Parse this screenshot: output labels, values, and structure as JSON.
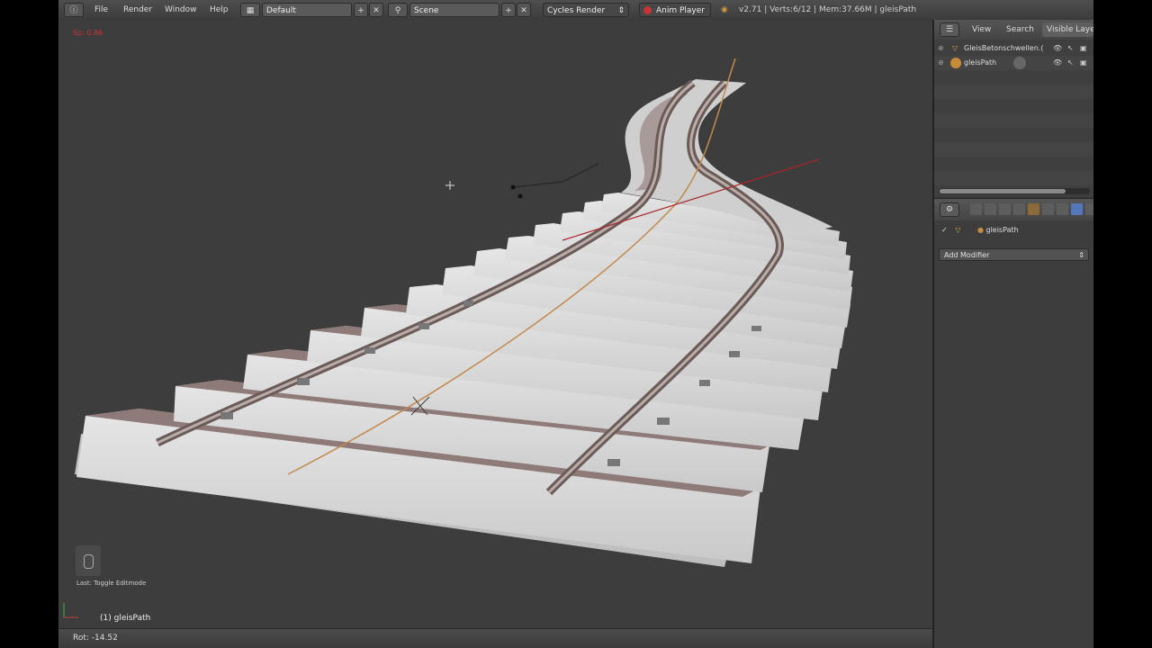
{
  "header": {
    "menu": [
      "File",
      "Render",
      "Window",
      "Help"
    ],
    "layout": "Default",
    "scene": "Scene",
    "render_engine": "Cycles Render",
    "anim_player": "Anim Player",
    "stats": "v2.71 | Verts:6/12 | Mem:37.66M | gleisPath"
  },
  "viewport": {
    "corner_text": "Sp: 0.86",
    "last_op": "Last: Toggle Editmode",
    "object_label": "(1) gleisPath",
    "status": "Rot: -14.52"
  },
  "outliner": {
    "tabs": [
      "View",
      "Search",
      "Visible Layers"
    ],
    "rows": [
      "GleisBetonschwellen.(",
      "gleisPath"
    ]
  },
  "properties": {
    "breadcrumb": "gleisPath",
    "add_modifier": "Add Modifier"
  },
  "colors": {
    "viewport_bg": "#3d3d3d",
    "sleeper": "#d9d9d9",
    "rail": "#7f6e6c",
    "path_orange": "#c28a4e",
    "axis_red": "#a8262a"
  }
}
